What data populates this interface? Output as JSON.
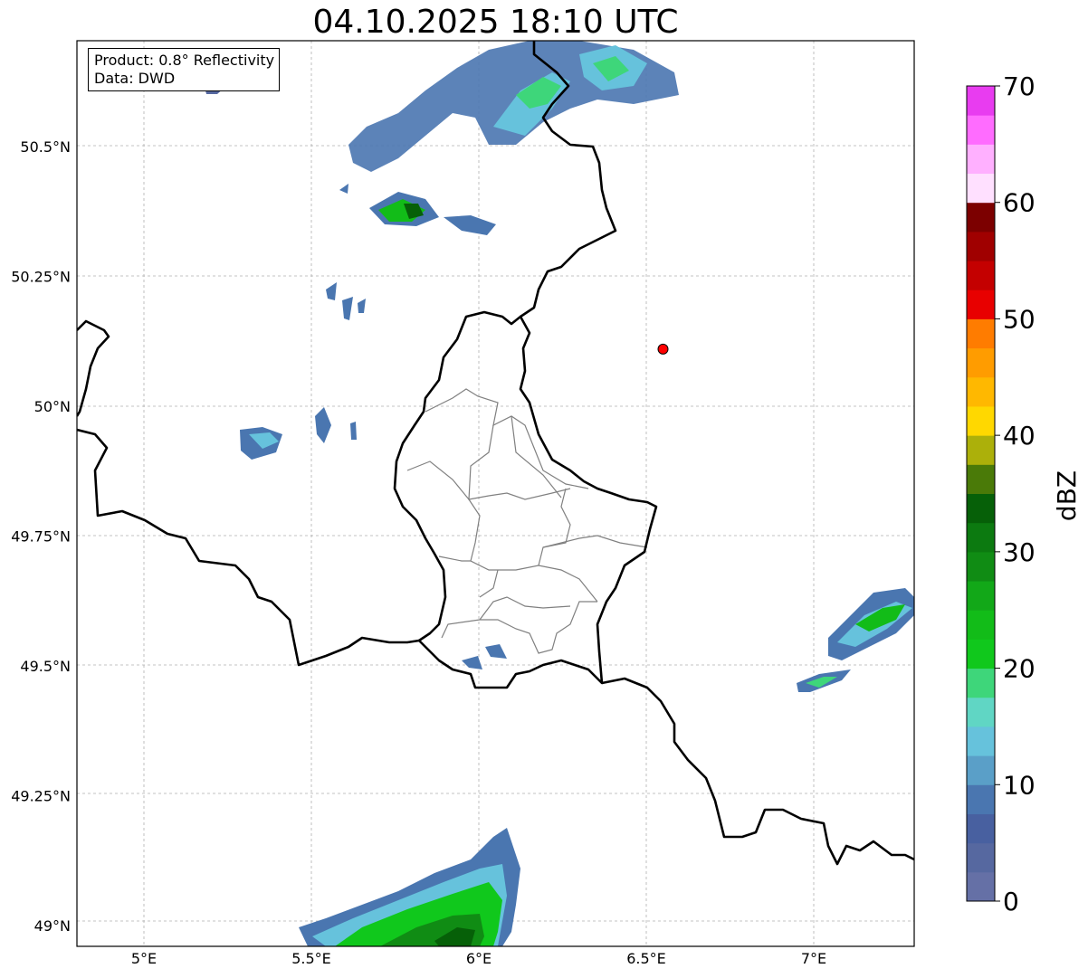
{
  "title": "04.10.2025 18:10 UTC",
  "info": {
    "product": "Product: 0.8° Reflectivity",
    "source": "Data: DWD"
  },
  "axes": {
    "x_ticks": [
      "5°E",
      "5.5°E",
      "6°E",
      "6.5°E",
      "7°E"
    ],
    "y_ticks": [
      "50.5°N",
      "50.25°N",
      "50°N",
      "49.75°N",
      "49.5°N",
      "49.25°N",
      "49°N"
    ],
    "lon_range": [
      4.8,
      7.3
    ],
    "lat_range": [
      48.95,
      50.7
    ],
    "grid": true
  },
  "marker": {
    "lon": 6.55,
    "lat": 50.11,
    "color": "#ff0000"
  },
  "colorbar": {
    "label": "dBZ",
    "ticks": [
      "0",
      "10",
      "20",
      "30",
      "40",
      "50",
      "60",
      "70"
    ],
    "range": [
      0,
      70
    ],
    "colors": [
      "#6570a6",
      "#5668a0",
      "#4860a0",
      "#4a76b0",
      "#5a9fc8",
      "#66c2dc",
      "#60d6c4",
      "#3ed67a",
      "#10c81c",
      "#12bc18",
      "#12a818",
      "#108c14",
      "#0c7a10",
      "#066008",
      "#4a7a08",
      "#acb00a",
      "#ffd800",
      "#ffb800",
      "#ff9c00",
      "#ff7c00",
      "#e80000",
      "#c40000",
      "#a00000",
      "#7c0000",
      "#ffe0ff",
      "#ffb0ff",
      "#ff6cff",
      "#e83cf0"
    ]
  },
  "colors": {
    "border": "#000000",
    "admin": "#808080",
    "grid": "#b0b0b0"
  }
}
